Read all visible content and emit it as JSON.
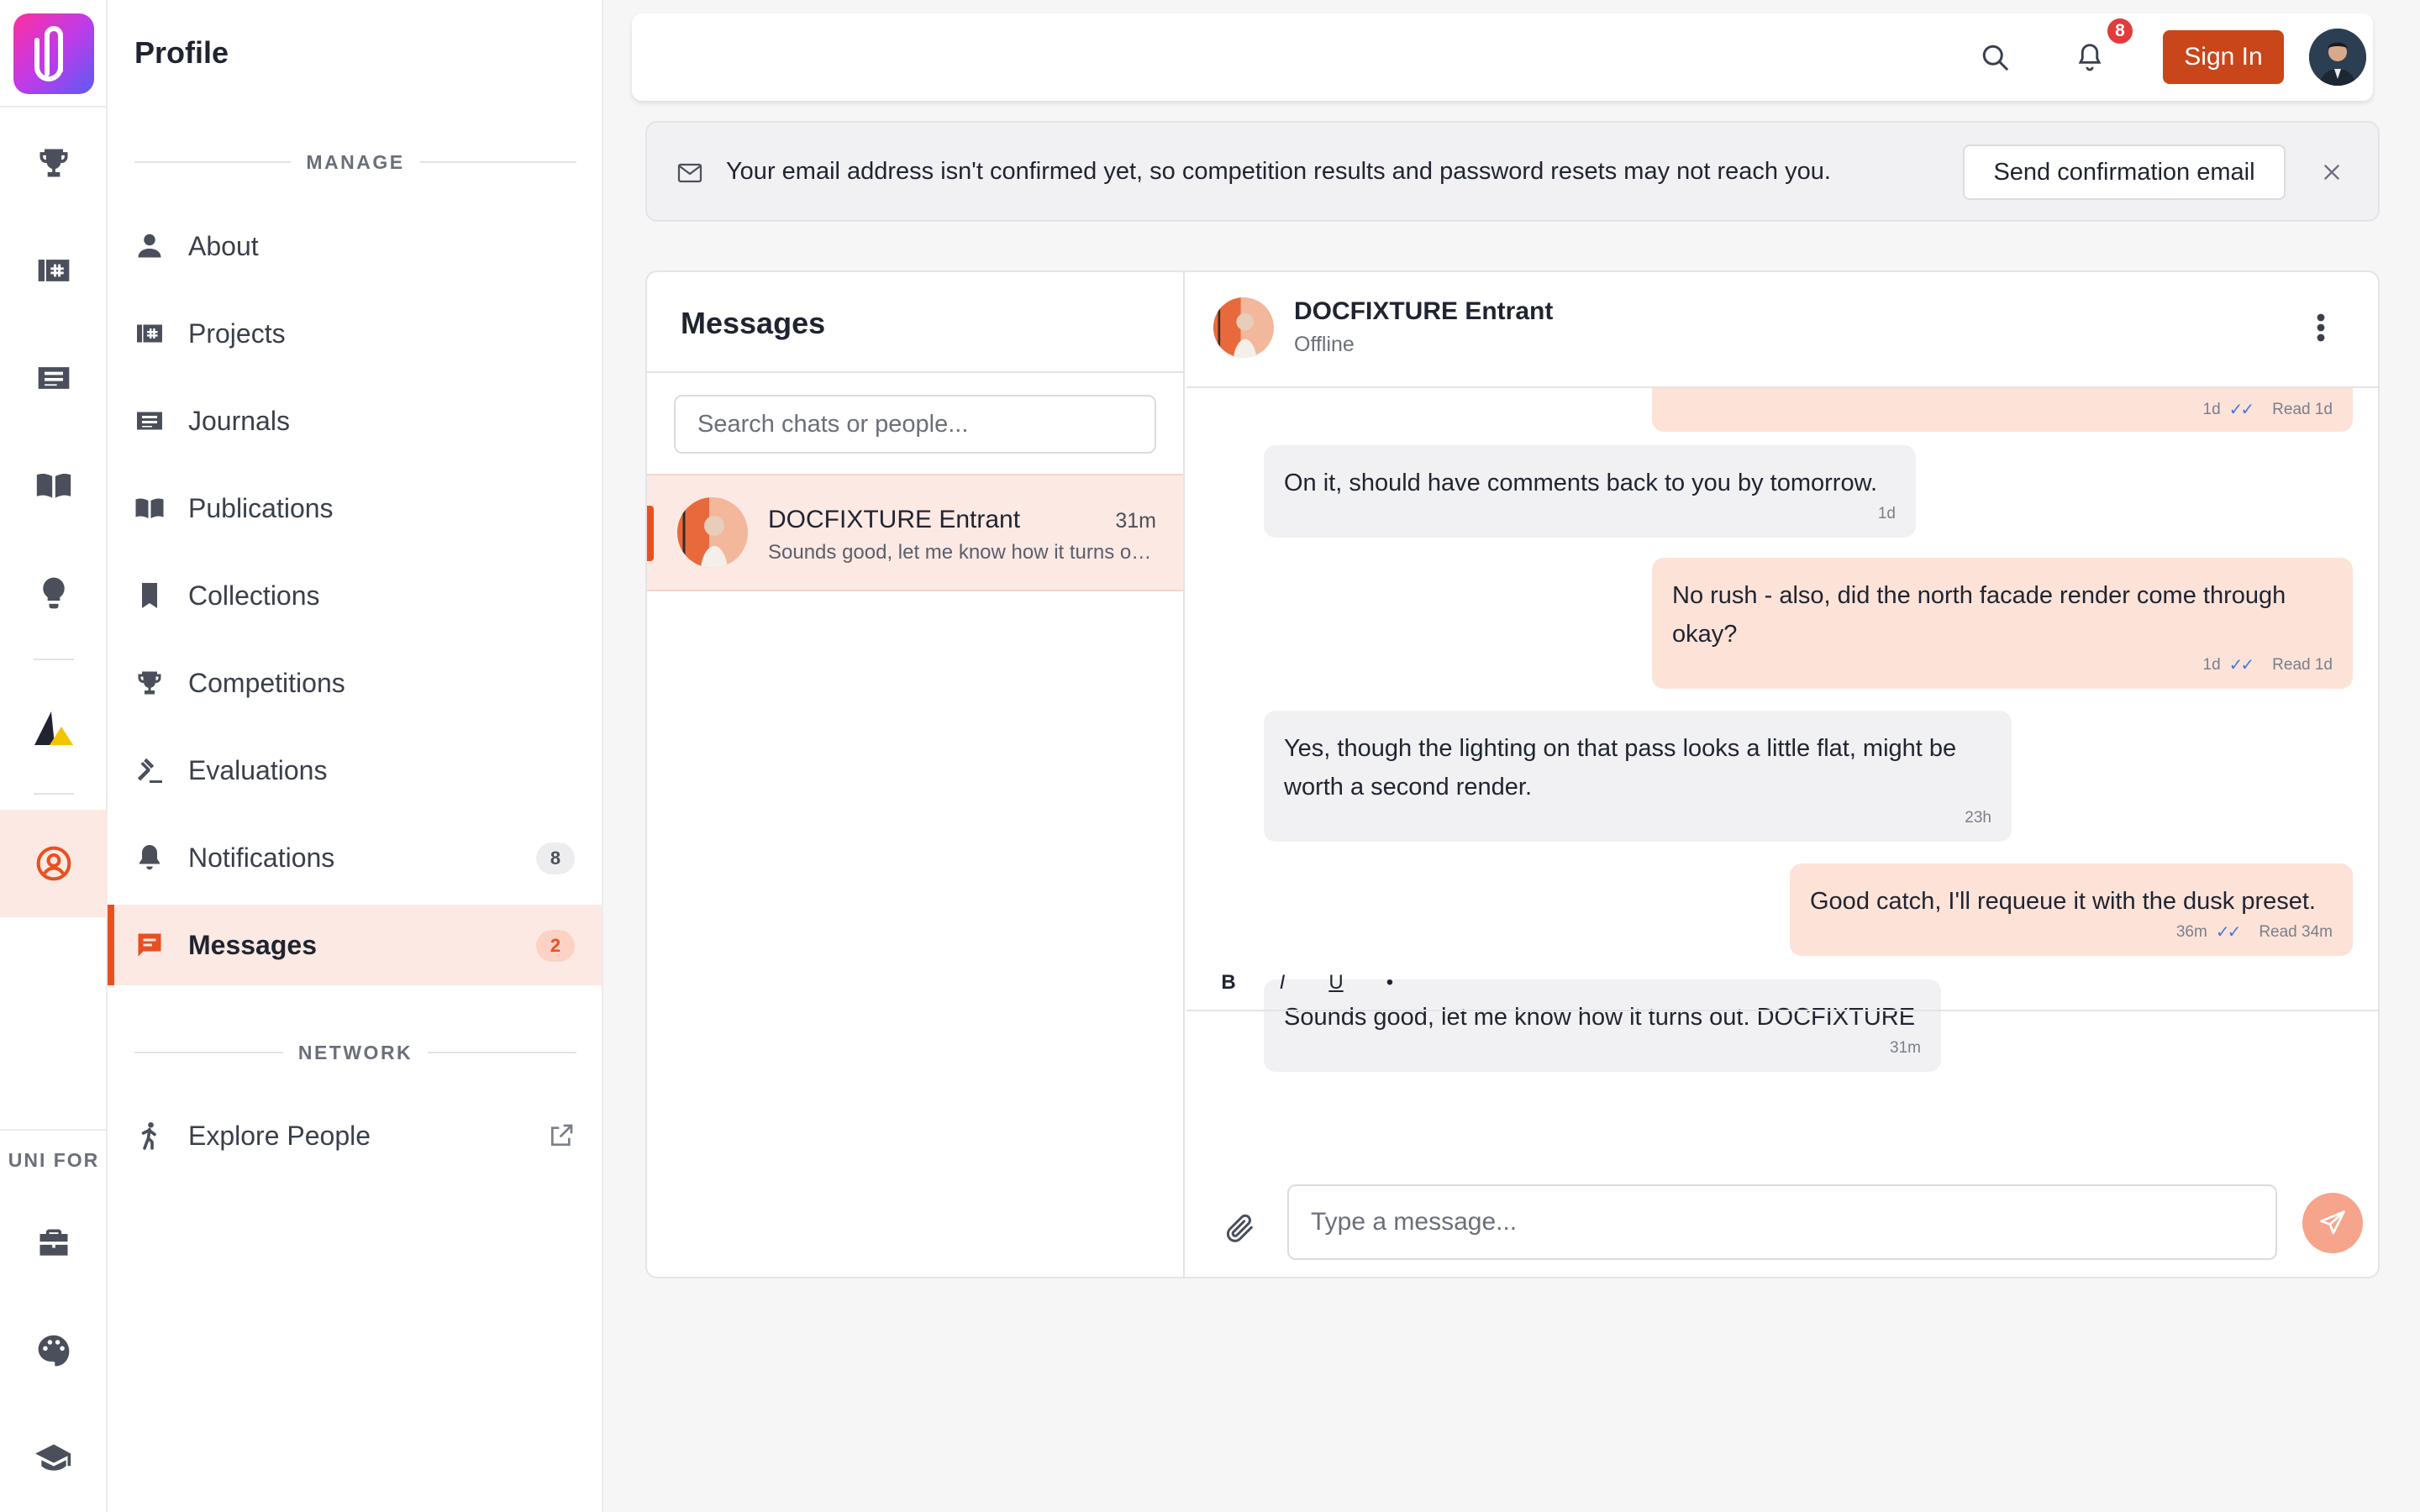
{
  "app": {
    "brand_color": "#e8501f"
  },
  "rail": {
    "label": "UNI FOR",
    "icons": [
      "trophy-icon",
      "projects-icon",
      "journals-icon",
      "book-icon",
      "lightbulb-icon",
      "triangle-logo-icon",
      "user-circle-icon",
      "briefcase-icon",
      "palette-icon",
      "graduation-cap-icon"
    ],
    "active": "user-circle-icon"
  },
  "sidenav": {
    "title": "Profile",
    "manage_heading": "MANAGE",
    "network_heading": "NETWORK",
    "items": [
      {
        "label": "About",
        "icon": "person-icon"
      },
      {
        "label": "Projects",
        "icon": "projects-icon"
      },
      {
        "label": "Journals",
        "icon": "journals-icon"
      },
      {
        "label": "Publications",
        "icon": "book-icon"
      },
      {
        "label": "Collections",
        "icon": "bookmark-icon"
      },
      {
        "label": "Competitions",
        "icon": "trophy-icon"
      },
      {
        "label": "Evaluations",
        "icon": "gavel-icon"
      },
      {
        "label": "Notifications",
        "icon": "bell-icon",
        "badge": "8"
      },
      {
        "label": "Messages",
        "icon": "chat-icon",
        "badge": "2",
        "active": true
      }
    ],
    "network_items": [
      {
        "label": "Explore People",
        "icon": "walking-person-icon",
        "external": true
      }
    ]
  },
  "topbar": {
    "notification_count": "8",
    "signin_label": "Sign In"
  },
  "banner": {
    "text": "Your email address isn't confirmed yet, so competition results and password resets may not reach you.",
    "button_label": "Send confirmation email"
  },
  "messages": {
    "title": "Messages",
    "search_placeholder": "Search chats or people...",
    "conversations": [
      {
        "name": "DOCFIXTURE Entrant",
        "time": "31m",
        "preview": "Sounds good, let me know how it turns out. DOCFIXTURE",
        "active": true
      }
    ],
    "thread": {
      "name": "DOCFIXTURE Entrant",
      "status": "Offline",
      "messages": [
        {
          "dir": "out",
          "text": "",
          "time": "1d",
          "read": "Read 1d"
        },
        {
          "dir": "in",
          "text": "On it, should have comments back to you by tomorrow.",
          "time": "1d"
        },
        {
          "dir": "out",
          "text": "No rush - also, did the north facade render come through okay?",
          "time": "1d",
          "read": "Read 1d"
        },
        {
          "dir": "in",
          "text": "Yes, though the lighting on that pass looks a little flat, might be worth a second render.",
          "time": "23h"
        },
        {
          "dir": "out",
          "text": "Good catch, I'll requeue it with the dusk preset.",
          "time": "36m",
          "read": "Read 34m"
        },
        {
          "dir": "in",
          "text": "Sounds good, let me know how it turns out. DOCFIXTURE",
          "time": "31m"
        }
      ]
    },
    "format_buttons": [
      "B",
      "I",
      "U",
      "•"
    ],
    "compose_placeholder": "Type a message..."
  }
}
